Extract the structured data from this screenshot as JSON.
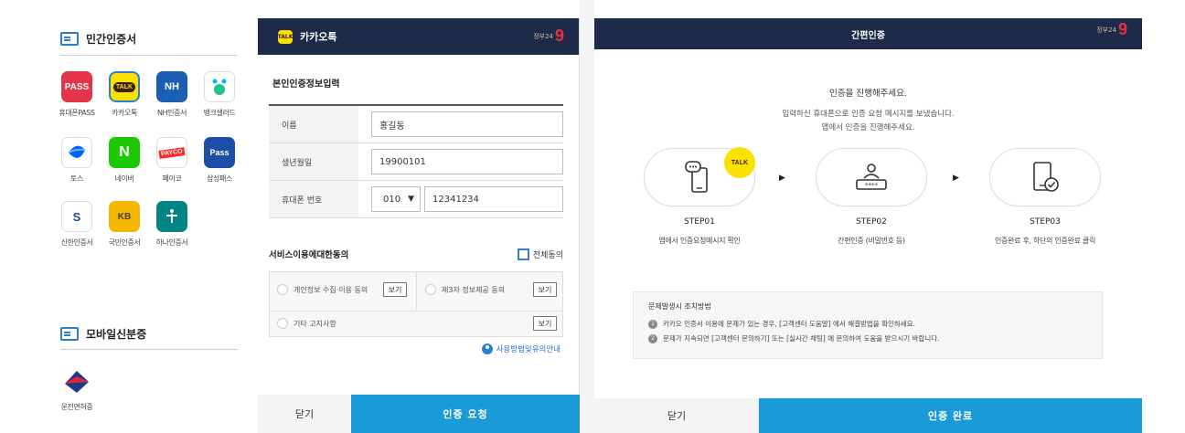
{
  "left": {
    "private_cert_title": "민간인증서",
    "apps": [
      {
        "badge": "PASS",
        "label": "휴대폰PASS",
        "color": "#e5334a"
      },
      {
        "badge": "TALK",
        "label": "카카오톡",
        "color": "#fae100"
      },
      {
        "badge": "NH",
        "label": "NH인증서",
        "color": "#1a5fb4"
      },
      {
        "badge": "",
        "label": "뱅크샐러드",
        "color": "#ffffff"
      },
      {
        "badge": "",
        "label": "토스",
        "color": "#ffffff"
      },
      {
        "badge": "N",
        "label": "네이버",
        "color": "#1ec800"
      },
      {
        "badge": "PAYCO",
        "label": "페이코",
        "color": "#ffffff"
      },
      {
        "badge": "Pass",
        "label": "삼성패스",
        "color": "#1d4fa6"
      },
      {
        "badge": "S",
        "label": "신한인증서",
        "color": "#ffffff"
      },
      {
        "badge": "KB",
        "label": "국민인증서",
        "color": "#f5b700"
      },
      {
        "badge": "",
        "label": "하나인증서",
        "color": "#008485"
      }
    ],
    "mobile_id_title": "모바일신분증",
    "mobile_id_label": "운전면허증"
  },
  "kakao": {
    "title": "카카오톡",
    "brand_text": "정부24",
    "brand_num": "9",
    "form_title": "본인인증정보입력",
    "name_label": "이름",
    "name_value": "홍길동",
    "birth_label": "생년월일",
    "birth_value": "19900101",
    "phone_label": "휴대폰 번호",
    "phone_prefix": "010",
    "phone_value": "12341234",
    "agree_title": "서비스이용에대한동의",
    "agree_all": "전체동의",
    "agree_items": [
      "개인정보 수집·이용 동의",
      "제3자 정보제공 동의",
      "기타 고지사항"
    ],
    "view_label": "보기",
    "guide_link": "사용방법및유의안내",
    "close_button": "닫기",
    "request_button": "인증 요청"
  },
  "simple": {
    "title": "간편인증",
    "msg1": "인증을 진행해주세요.",
    "msg2a": "입력하신 휴대폰으로 인증 요청 메시지를 보냈습니다.",
    "msg2b": "앱에서 인증을 진행해주세요.",
    "steps": [
      {
        "label": "STEP01",
        "desc": "앱에서 인증요청메시지 확인"
      },
      {
        "label": "STEP02",
        "desc": "간편인증 (비밀번호 등)"
      },
      {
        "label": "STEP03",
        "desc": "인증완료 후, 하단의 인증완료 클릭"
      }
    ],
    "talk_badge": "TALK",
    "notice_title": "문제발생시 조치방법",
    "notice_1": "카카오 인증서 이용에 문제가 있는 경우, [고객센터 도움말] 에서 해결방법을 확인하세요.",
    "notice_2": "문제가 지속되면 [고객센터 문의하기] 또는 [실시간 채팅] 에 문의하여 도움을 받으시기 바랍니다.",
    "close_button": "닫기",
    "done_button": "인증 완료"
  }
}
